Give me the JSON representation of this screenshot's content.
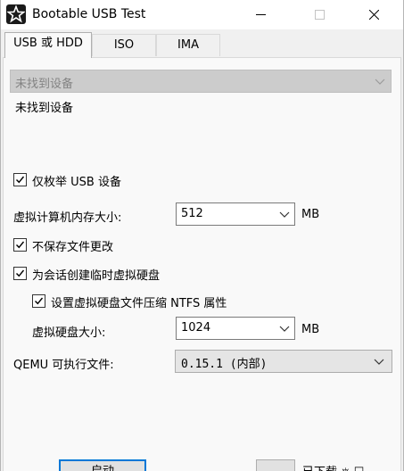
{
  "window": {
    "title": "Bootable USB Test",
    "icon": "star-app-icon"
  },
  "tabs": [
    {
      "label": "USB 或 HDD",
      "active": true
    },
    {
      "label": "ISO",
      "active": false
    },
    {
      "label": "IMA",
      "active": false
    }
  ],
  "device": {
    "combo_value": "未找到设备",
    "combo_enabled": false,
    "status_label": "未找到设备"
  },
  "options": {
    "usb_only": {
      "label": "仅枚举 USB 设备",
      "checked": true
    },
    "memory_label": "虚拟计算机内存大小:",
    "memory_value": "512",
    "memory_unit": "MB",
    "no_save": {
      "label": "不保存文件更改",
      "checked": true
    },
    "create_temp_disk": {
      "label": "为会话创建临时虚拟硬盘",
      "checked": true
    },
    "ntfs_compress": {
      "label": "设置虚拟硬盘文件压缩 NTFS 属性",
      "checked": true
    },
    "disk_size_label": "虚拟硬盘大小:",
    "disk_size_value": "1024",
    "disk_size_unit": "MB",
    "qemu_label": "QEMU 可执行文件:",
    "qemu_value": "0.15.1 (内部)"
  },
  "footer": {
    "start_label": "启动",
    "status_text": "已下载 ⎈ ☐"
  },
  "colors": {
    "accent": "#0078d7",
    "background": "#f0f0f0"
  }
}
